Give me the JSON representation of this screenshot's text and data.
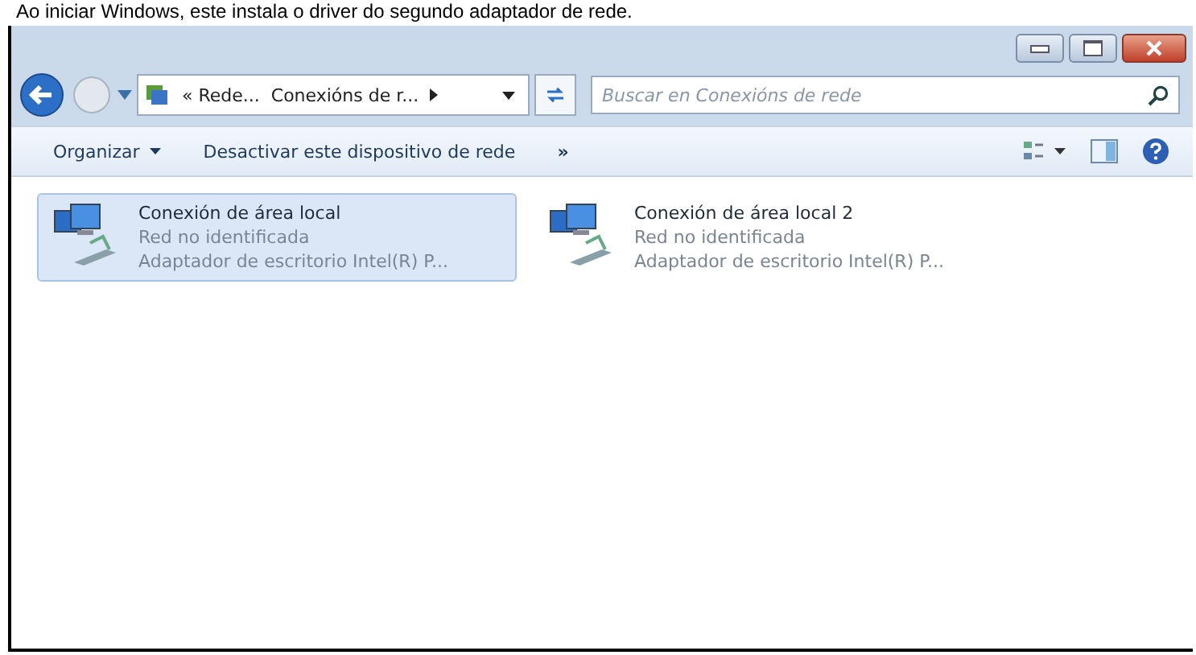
{
  "caption": "Ao iniciar Windows, este instala o driver do segundo adaptador de rede.",
  "address": {
    "crumbs": [
      "« Rede...",
      "Conexións de r..."
    ]
  },
  "search": {
    "placeholder": "Buscar en Conexións de rede"
  },
  "toolbar": {
    "items": [
      "Organizar",
      "Desactivar este dispositivo de rede"
    ],
    "more": "»"
  },
  "connections": [
    {
      "name": "Conexión de área local",
      "status": "Red no identificada",
      "adapter": "Adaptador de escritorio Intel(R) P...",
      "selected": true
    },
    {
      "name": "Conexión de área local 2",
      "status": "Red no identificada",
      "adapter": "Adaptador de escritorio Intel(R) P...",
      "selected": false
    }
  ]
}
